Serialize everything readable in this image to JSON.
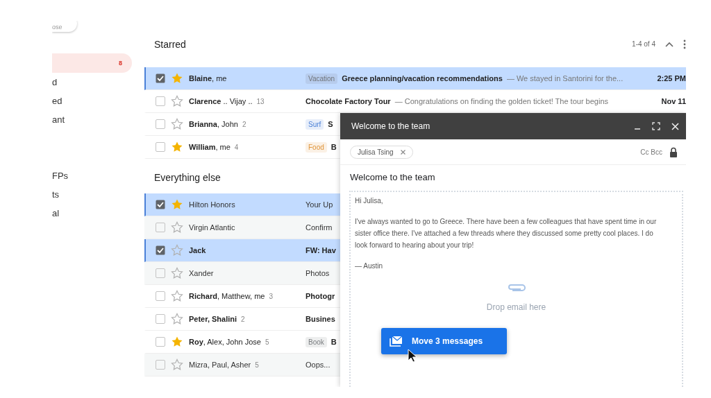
{
  "sidebar": {
    "compose_label": "ose",
    "items": [
      {
        "count": "8",
        "selected": true
      },
      {
        "label": "d",
        "selected": false
      },
      {
        "label": "ed",
        "selected": false
      },
      {
        "label": "ant",
        "selected": false
      },
      {
        "label": "FPs",
        "selected": false
      },
      {
        "label": "ts",
        "selected": false
      },
      {
        "label": "al",
        "selected": false
      }
    ]
  },
  "sections": [
    {
      "title": "Starred",
      "pagination": "1-4 of 4",
      "rows": [
        {
          "sender": "**Blaine**, me",
          "selected": true,
          "starred": true,
          "unread": true,
          "label": {
            "text": "Vacation",
            "color": "#6f7378"
          },
          "subject": "Greece planning/vacation recommendations",
          "snippet": "— We stayed in Santorini for the...",
          "date": "2:25 PM"
        },
        {
          "sender": "**Clarence** .. Vijay ..",
          "count": "13",
          "selected": false,
          "starred": false,
          "unread": true,
          "subject": "Chocolate Factory Tour",
          "snippet": "— Congratulations on finding the golden ticket! The tour begins",
          "date": "Nov 11"
        },
        {
          "sender": "**Brianna**, John",
          "count": "2",
          "selected": false,
          "starred": false,
          "unread": true,
          "label": {
            "text": "Surf",
            "color": "#4a7fd6"
          },
          "subject": "S"
        },
        {
          "sender": "**William**, me",
          "count": "4",
          "selected": false,
          "starred": true,
          "unread": true,
          "label": {
            "text": "Food",
            "color": "#e0953a"
          },
          "subject": "B"
        }
      ]
    },
    {
      "title": "Everything else",
      "rows": [
        {
          "sender": "Hilton Honors",
          "selected": true,
          "starred": true,
          "unread": false,
          "subject": "Your Up"
        },
        {
          "sender": "Virgin Atlantic",
          "selected": false,
          "starred": false,
          "unread": false,
          "subject": "Confirm"
        },
        {
          "sender": "Jack",
          "sender_bold": true,
          "selected": true,
          "starred": false,
          "unread": true,
          "subject": "FW: Hav"
        },
        {
          "sender": "Xander",
          "selected": false,
          "starred": false,
          "unread": false,
          "subject": "Photos"
        },
        {
          "sender": "**Richard**, Matthew, me",
          "count": "3",
          "selected": false,
          "starred": false,
          "unread": true,
          "subject": "Photogr"
        },
        {
          "sender": "Peter, Shalini",
          "sender_bold": true,
          "count": "2",
          "selected": false,
          "starred": false,
          "unread": true,
          "subject": "Busines"
        },
        {
          "sender": "**Roy**, Alex, John Jose",
          "count": "5",
          "selected": false,
          "starred": true,
          "unread": true,
          "label": {
            "text": "Book",
            "color": "#7a7d80"
          },
          "subject": "B"
        },
        {
          "sender": "Mizra, Paul, Asher",
          "count": "5",
          "selected": false,
          "starred": false,
          "unread": false,
          "subject": "Oops..."
        }
      ]
    }
  ],
  "compose": {
    "title": "Welcome to the team",
    "recipient": "Julisa Tsing",
    "cc_bcc": "Cc Bcc",
    "subject": "Welcome to the team",
    "body": [
      "Hi Julisa,",
      "I've always wanted to go to Greece. There have been a few colleagues that have spent time in our sister office there. I've attached a few threads where they discussed some pretty cool places. I do look forward to hearing about your trip!",
      "— Austin"
    ],
    "drop_hint": "Drop email here",
    "drag_button": "Move 3 messages"
  }
}
